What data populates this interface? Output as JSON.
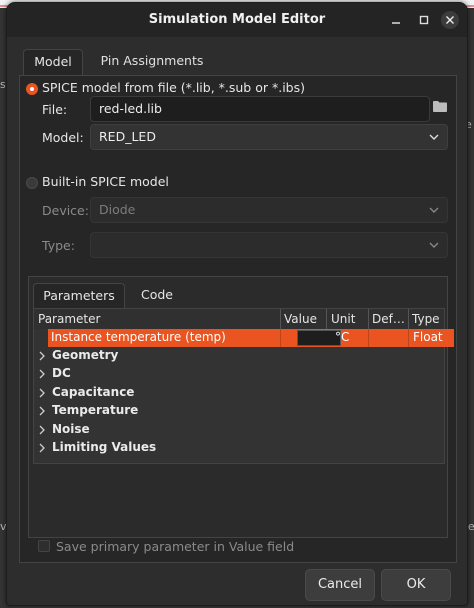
{
  "window": {
    "title": "Simulation Model Editor"
  },
  "background": {
    "left_glyphs": [
      "s",
      "v"
    ],
    "right_glyphs": [
      "e",
      "Le"
    ]
  },
  "tabs": [
    {
      "label": "Model",
      "active": true
    },
    {
      "label": "Pin Assignments",
      "active": false
    }
  ],
  "spice_file": {
    "radio_label": "SPICE model from file (*.lib, *.sub or *.ibs)",
    "selected": true,
    "file_label": "File:",
    "file_value": "red-led.lib",
    "model_label": "Model:",
    "model_value": "RED_LED"
  },
  "builtin": {
    "radio_label": "Built-in SPICE model",
    "selected": false,
    "device_label": "Device:",
    "device_value": "Diode",
    "type_label": "Type:",
    "type_value": ""
  },
  "param_tabs": [
    {
      "label": "Parameters",
      "active": true
    },
    {
      "label": "Code",
      "active": false
    }
  ],
  "grid": {
    "columns": [
      "Parameter",
      "Value",
      "Unit",
      "Def…",
      "Type"
    ],
    "selected_row": {
      "parameter": "Instance temperature (temp)",
      "value": "",
      "unit": "°C",
      "default": "",
      "type": "Float"
    },
    "groups": [
      "Geometry",
      "DC",
      "Capacitance",
      "Temperature",
      "Noise",
      "Limiting Values"
    ]
  },
  "save_primary": {
    "label": "Save primary parameter in Value field",
    "checked": false
  },
  "buttons": {
    "cancel": "Cancel",
    "ok": "OK"
  },
  "colors": {
    "accent": "#e95420",
    "dialog_bg": "#2d2d2d",
    "titlebar_bg": "#242424"
  },
  "icons": [
    "minimize-icon",
    "maximize-icon",
    "close-icon",
    "folder-icon",
    "chevron-down-icon",
    "chevron-right-icon"
  ]
}
